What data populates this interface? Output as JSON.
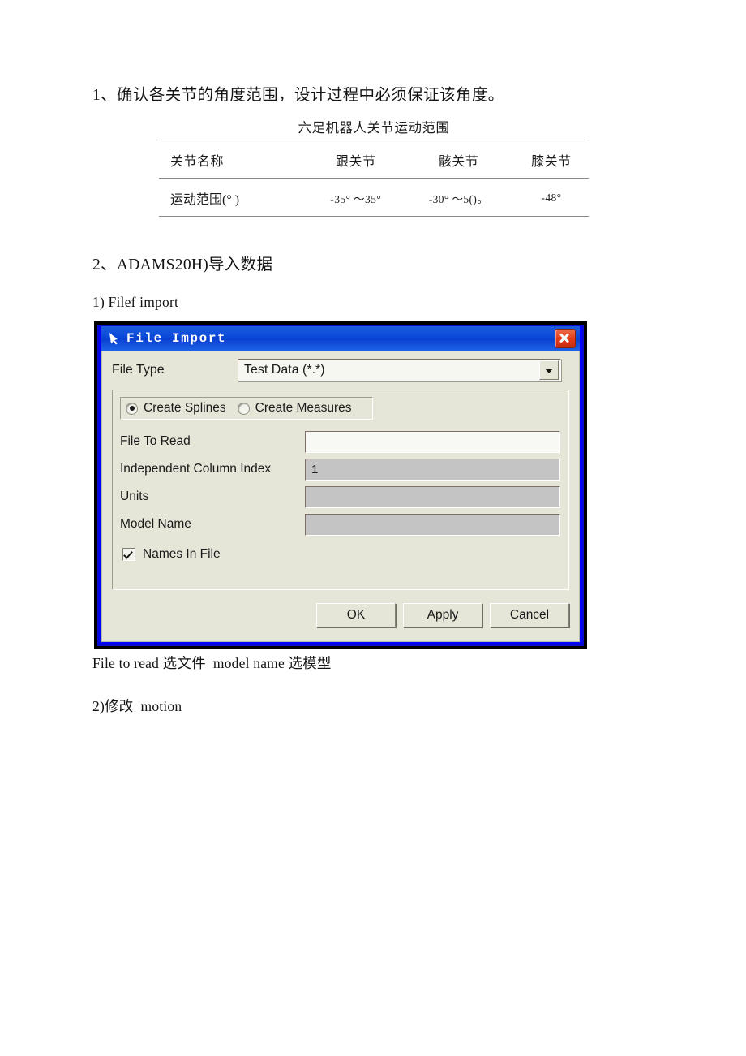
{
  "document": {
    "section_1_heading": "1、确认各关节的角度范围，设计过程中必须保证该角度。",
    "section_2_heading": "2、ADAMS20H)导入数据",
    "subsection_1": "1) Filef import",
    "caption_below_dialog": "File to read 选文件  model name 选模型",
    "subsection_2": "2)修改  motion"
  },
  "joint_table": {
    "caption": "六足机器人关节运动范围",
    "headers": [
      "关节名称",
      "跟关节",
      "骸关节",
      "膝关节"
    ],
    "rows": [
      {
        "label": "运动范围(°   )",
        "values": [
          "-35°  ～35°",
          "-30°  ～5()。",
          "-48°"
        ]
      }
    ]
  },
  "dialog": {
    "title": "File Import",
    "title_icon": "adams-file-icon",
    "close_icon": "close-icon",
    "file_type": {
      "label": "File Type",
      "selected": "Test Data (*.*)",
      "arrow_icon": "chevron-down-icon"
    },
    "radio_group": {
      "options": [
        {
          "label": "Create Splines",
          "selected": true
        },
        {
          "label": "Create Measures",
          "selected": false
        }
      ]
    },
    "fields": [
      {
        "label": "File To Read",
        "value": "",
        "state": "editable"
      },
      {
        "label": "Independent Column Index",
        "value": "1",
        "state": "readonly"
      },
      {
        "label": "Units",
        "value": "",
        "state": "readonly"
      },
      {
        "label": "Model Name",
        "value": "",
        "state": "readonly"
      }
    ],
    "checkbox": {
      "label": "Names In File",
      "checked": true
    },
    "buttons": [
      "OK",
      "Apply",
      "Cancel"
    ],
    "colors": {
      "titlebar": "#0a47d8",
      "close_button": "#e23a1a",
      "face": "#e6e6d8",
      "readonly_field": "#c4c4c4",
      "editable_field": "#f8f8f4"
    }
  }
}
